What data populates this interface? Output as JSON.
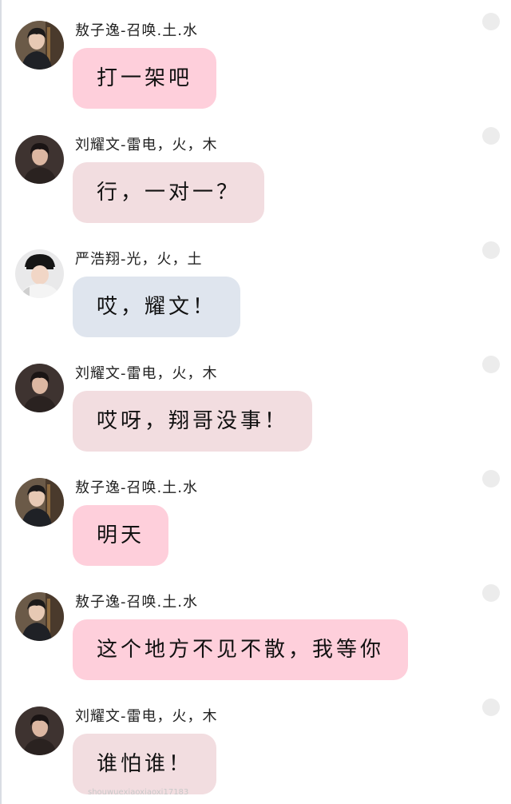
{
  "colors": {
    "bubble_pink": "#fecfdb",
    "bubble_rose": "#f2dde0",
    "bubble_blue": "#dfe5ee",
    "dot": "#ececec"
  },
  "messages": [
    {
      "sender": "敖子逸-召唤.土.水",
      "text": "打一架吧",
      "bubble_color": "pink",
      "avatar": "avatar-azy"
    },
    {
      "sender": "刘耀文-雷电，火，木",
      "text": "行，一对一？",
      "bubble_color": "rose",
      "avatar": "avatar-lyw"
    },
    {
      "sender": "严浩翔-光，火，土",
      "text": "哎，耀文！",
      "bubble_color": "blue",
      "avatar": "avatar-yhx"
    },
    {
      "sender": "刘耀文-雷电，火，木",
      "text": "哎呀，翔哥没事！",
      "bubble_color": "rose",
      "avatar": "avatar-lyw"
    },
    {
      "sender": "敖子逸-召唤.土.水",
      "text": "明天",
      "bubble_color": "pink",
      "avatar": "avatar-azy"
    },
    {
      "sender": "敖子逸-召唤.土.水",
      "text": "这个地方不见不散，我等你",
      "bubble_color": "pink",
      "avatar": "avatar-azy"
    },
    {
      "sender": "刘耀文-雷电，火，木",
      "text": "谁怕谁！",
      "bubble_color": "rose",
      "avatar": "avatar-lyw"
    }
  ],
  "watermark": "shouwuexiaoxiaoxi17183"
}
